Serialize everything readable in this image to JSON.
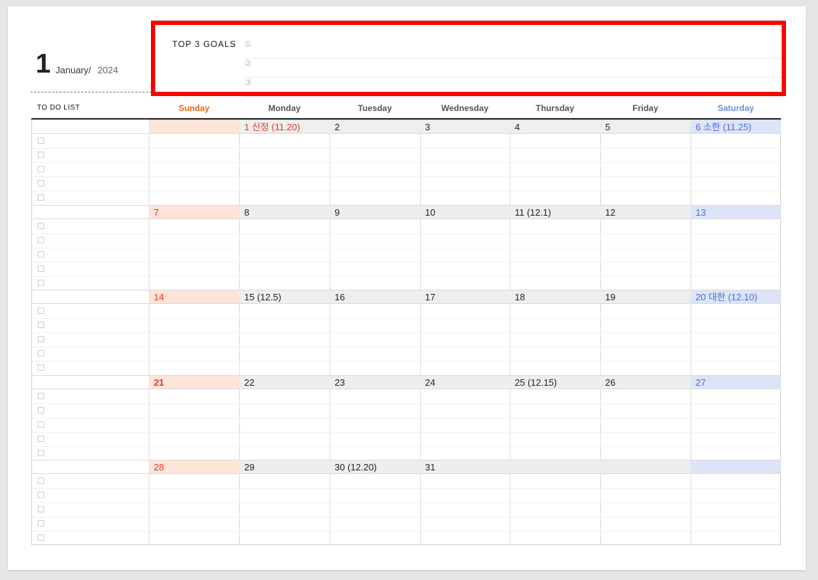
{
  "header": {
    "month_number": "1",
    "month_name": "January/",
    "year": "2024"
  },
  "goals": {
    "title": "TOP 3 GOALS",
    "markers": [
      "①",
      "②",
      "③"
    ]
  },
  "todo": {
    "label": "TO DO LIST"
  },
  "weekdays": [
    "Sunday",
    "Monday",
    "Tuesday",
    "Wednesday",
    "Thursday",
    "Friday",
    "Saturday"
  ],
  "colors": {
    "sunday": "#e8641a",
    "saturday": "#6f8fd8",
    "sunday_bg": "#fde4d9",
    "saturday_bg": "#dde4f7",
    "highlight": "#ff0000"
  },
  "weeks": [
    [
      "",
      "1  신정  (11.20)",
      "2",
      "3",
      "4",
      "5",
      "6  소한  (11.25)"
    ],
    [
      "7",
      "8",
      "9",
      "10",
      "11  (12.1)",
      "12",
      "13"
    ],
    [
      "14",
      "15  (12.5)",
      "16",
      "17",
      "18",
      "19",
      "20  대한  (12.10)"
    ],
    [
      "21",
      "22",
      "23",
      "24",
      "25  (12.15)",
      "26",
      "27"
    ],
    [
      "28",
      "29",
      "30  (12.20)",
      "31",
      "",
      "",
      ""
    ]
  ]
}
